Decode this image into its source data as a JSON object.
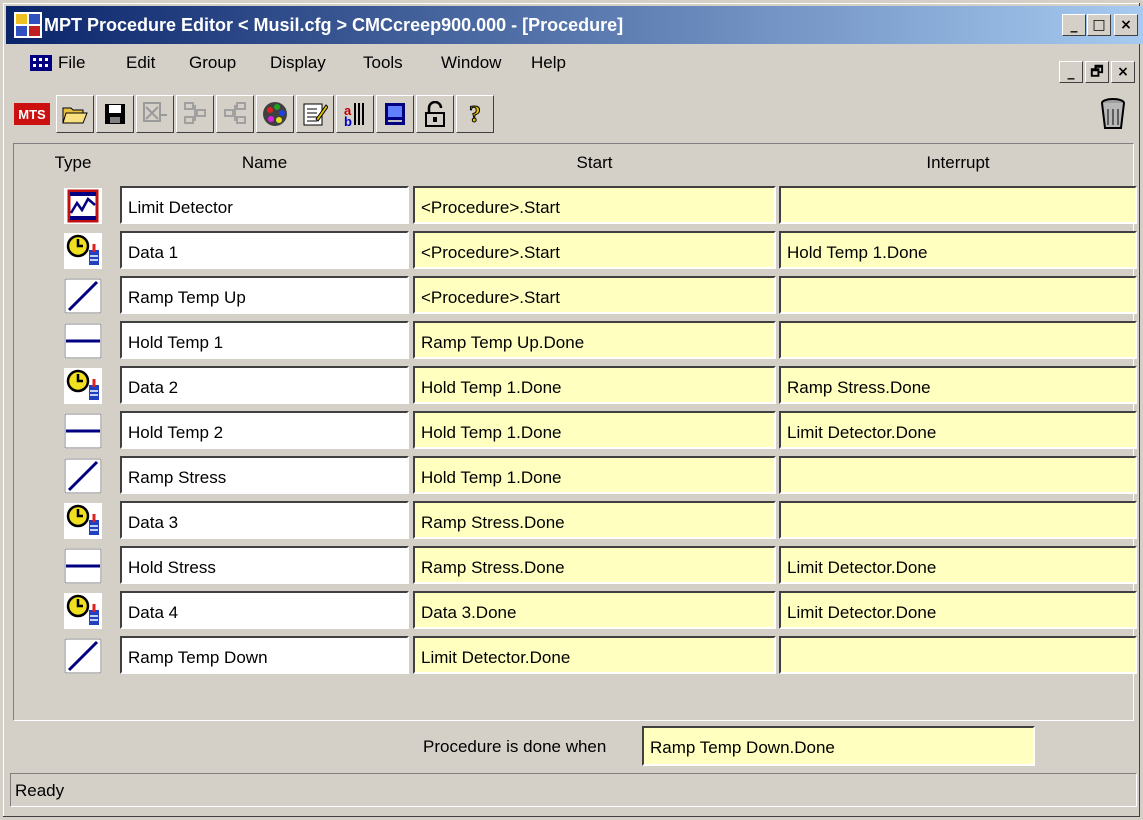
{
  "window": {
    "title": "MPT Procedure Editor  < Musil.cfg >  CMCcreep900.000 - [Procedure]",
    "caption_buttons": [
      "_",
      "□",
      "×"
    ],
    "child_buttons": [
      "_",
      "🗗",
      "×"
    ]
  },
  "menu": [
    "File",
    "Edit",
    "Group",
    "Display",
    "Tools",
    "Window",
    "Help"
  ],
  "toolbar": [
    "mts-logo-icon",
    "open-folder-icon",
    "save-icon",
    "delete-process-icon",
    "group-icon",
    "ungroup-icon",
    "palette-icon",
    "edit-notes-icon",
    "signals-icon",
    "station-icon",
    "lock-icon",
    "help-icon",
    "trash-icon"
  ],
  "columns": {
    "type": "Type",
    "name": "Name",
    "start": "Start",
    "interrupt": "Interrupt"
  },
  "rows": [
    {
      "icon": "limit-detector-icon",
      "name": "Limit Detector",
      "start": "<Procedure>.Start",
      "interrupt": ""
    },
    {
      "icon": "data-acquisition-icon",
      "name": "Data 1",
      "start": "<Procedure>.Start",
      "interrupt": "Hold Temp 1.Done"
    },
    {
      "icon": "ramp-icon",
      "name": "Ramp Temp Up",
      "start": "<Procedure>.Start",
      "interrupt": ""
    },
    {
      "icon": "hold-icon",
      "name": "Hold Temp 1",
      "start": "Ramp Temp Up.Done",
      "interrupt": ""
    },
    {
      "icon": "data-acquisition-icon",
      "name": "Data 2",
      "start": "Hold Temp 1.Done",
      "interrupt": "Ramp Stress.Done"
    },
    {
      "icon": "hold-icon",
      "name": "Hold Temp 2",
      "start": "Hold Temp 1.Done",
      "interrupt": "Limit Detector.Done"
    },
    {
      "icon": "ramp-icon",
      "name": "Ramp Stress",
      "start": "Hold Temp 1.Done",
      "interrupt": ""
    },
    {
      "icon": "data-acquisition-icon",
      "name": "Data 3",
      "start": "Ramp Stress.Done",
      "interrupt": ""
    },
    {
      "icon": "hold-icon",
      "name": "Hold Stress",
      "start": "Ramp Stress.Done",
      "interrupt": "Limit Detector.Done"
    },
    {
      "icon": "data-acquisition-icon",
      "name": "Data 4",
      "start": "Data 3.Done",
      "interrupt": "Limit Detector.Done"
    },
    {
      "icon": "ramp-icon",
      "name": "Ramp Temp Down",
      "start": "Limit Detector.Done",
      "interrupt": ""
    }
  ],
  "footer": {
    "label": "Procedure is done when",
    "value": "Ramp Temp Down.Done"
  },
  "status": "Ready"
}
